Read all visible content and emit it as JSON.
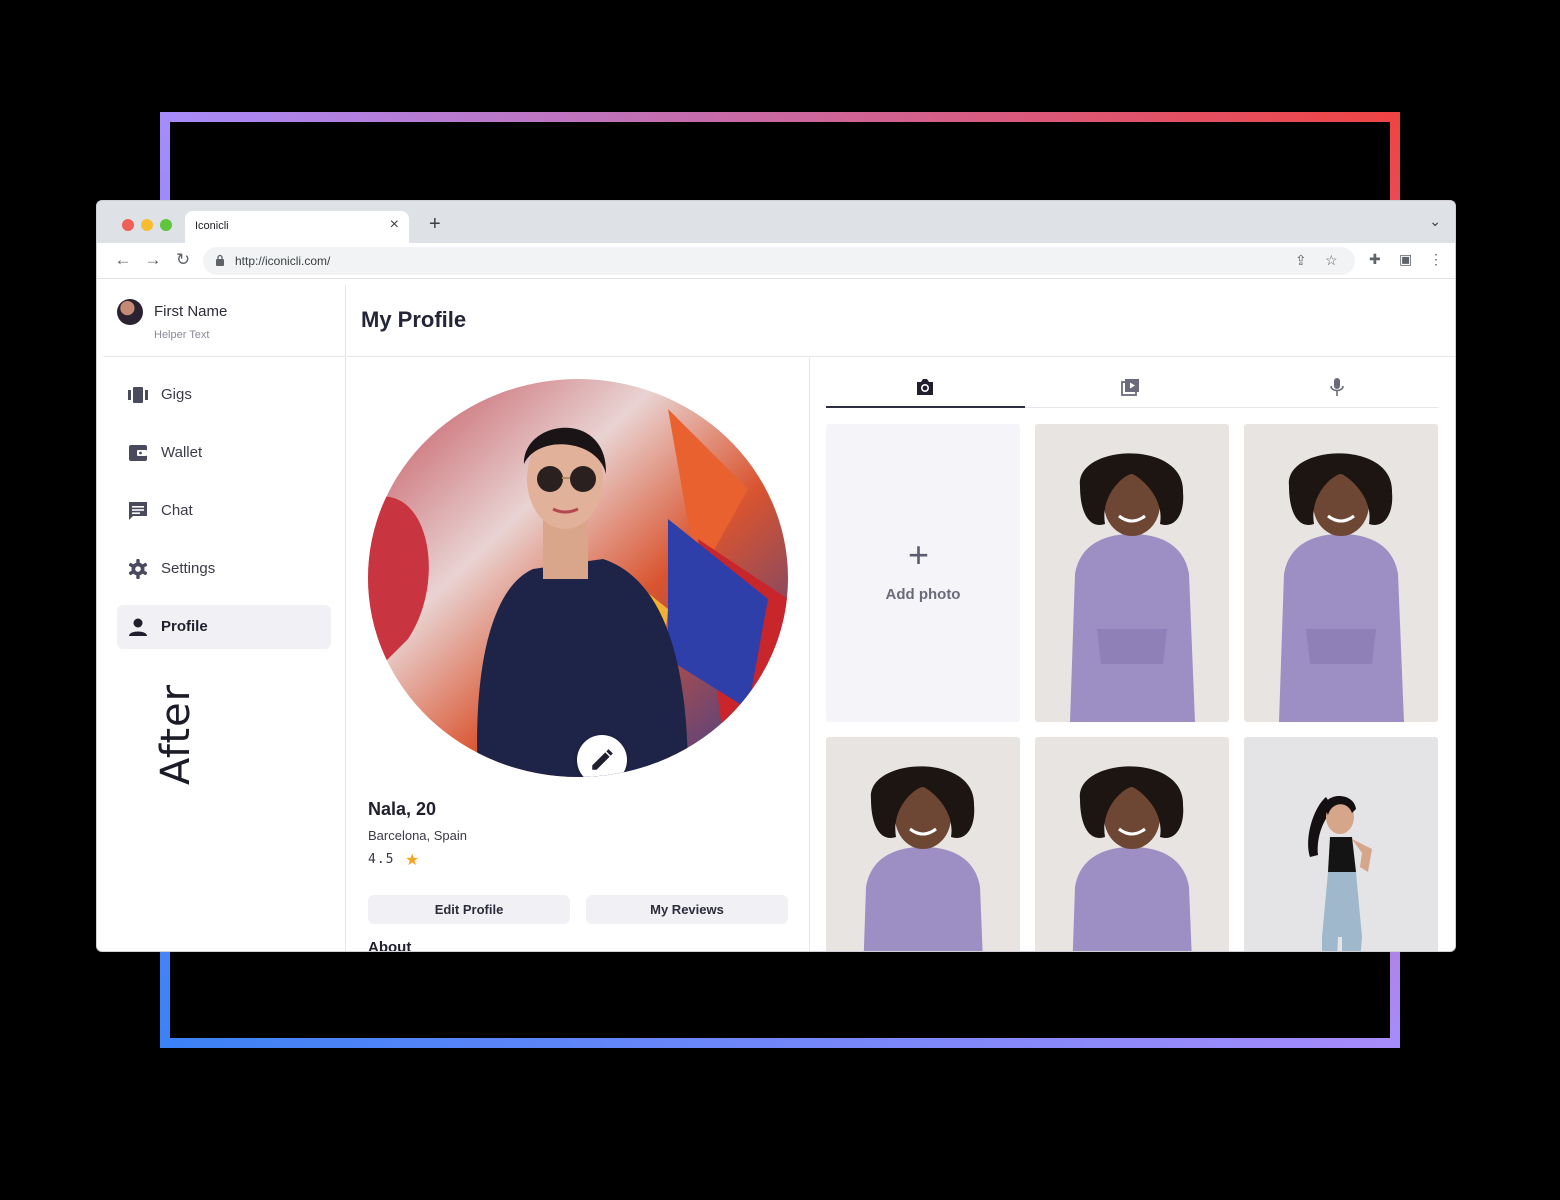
{
  "browser": {
    "tab_title": "Iconicli",
    "url": "http://iconicli.com/"
  },
  "user": {
    "name": "First Name",
    "helper": "Helper Text"
  },
  "nav": [
    {
      "label": "Gigs",
      "icon": "gigs-icon",
      "active": false
    },
    {
      "label": "Wallet",
      "icon": "wallet-icon",
      "active": false
    },
    {
      "label": "Chat",
      "icon": "chat-icon",
      "active": false
    },
    {
      "label": "Settings",
      "icon": "gear-icon",
      "active": false
    },
    {
      "label": "Profile",
      "icon": "person-icon",
      "active": true
    }
  ],
  "overlay_label": "After",
  "page": {
    "title": "My Profile"
  },
  "profile": {
    "name_age": "Nala, 20",
    "location": "Barcelona, Spain",
    "rating": "4.5",
    "edit_label": "Edit Profile",
    "reviews_label": "My Reviews",
    "about_heading": "About"
  },
  "media": {
    "tabs": [
      "camera-icon",
      "video-icon",
      "microphone-icon"
    ],
    "active_tab": 0,
    "add_label": "Add photo"
  },
  "colors": {
    "accent": "#2e2e42",
    "hoodie": "#9d8fc4",
    "star": "#f0a623",
    "gradient_start": "#3b82f6",
    "gradient_mid": "#a78bfa",
    "gradient_end": "#ef4444"
  }
}
